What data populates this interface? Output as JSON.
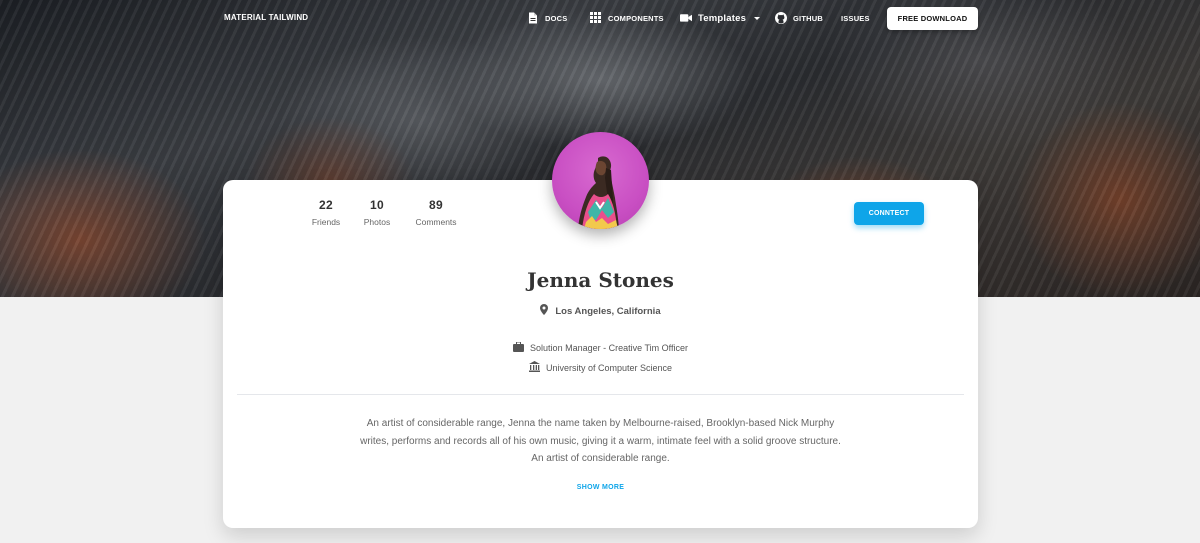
{
  "navbar": {
    "brand": "MATERIAL TAILWIND",
    "items": [
      {
        "label": "DOCS",
        "icon": "document-icon"
      },
      {
        "label": "COMPONENTS",
        "icon": "grid-icon"
      },
      {
        "label": "Templates",
        "icon": "video-icon"
      },
      {
        "label": "GITHUB",
        "icon": "github-icon"
      },
      {
        "label": "ISSUES"
      }
    ],
    "cta": "FREE DOWNLOAD"
  },
  "profile": {
    "stats": [
      {
        "value": "22",
        "label": "Friends"
      },
      {
        "value": "10",
        "label": "Photos"
      },
      {
        "value": "89",
        "label": "Comments"
      }
    ],
    "connect_label": "CONNTECT",
    "name": "Jenna Stones",
    "location": "Los Angeles, California",
    "job": "Solution Manager - Creative Tim Officer",
    "education": "University of Computer Science",
    "bio_lines": [
      "An artist of considerable range, Jenna the name taken by Melbourne-raised, Brooklyn-based Nick Murphy",
      "writes, performs and records all of his own music, giving it a warm, intimate feel with a solid groove structure.",
      "An artist of considerable range."
    ],
    "show_more": "SHOW MORE"
  },
  "colors": {
    "accent": "#0ea5e9",
    "avatar_bg": "#c94fc3",
    "page_bg": "#f1f1f1"
  }
}
